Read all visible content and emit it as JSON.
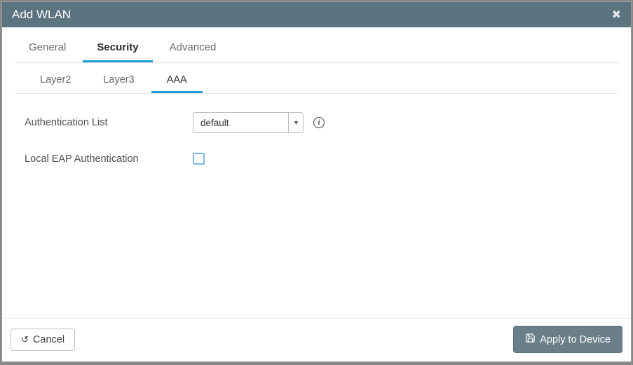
{
  "modal": {
    "title": "Add WLAN"
  },
  "tabs": {
    "general": "General",
    "security": "Security",
    "advanced": "Advanced"
  },
  "subtabs": {
    "layer2": "Layer2",
    "layer3": "Layer3",
    "aaa": "AAA"
  },
  "form": {
    "auth_list_label": "Authentication List",
    "auth_list_value": "default",
    "local_eap_label": "Local EAP Authentication",
    "local_eap_checked": false
  },
  "footer": {
    "cancel": "Cancel",
    "apply": "Apply to Device"
  },
  "icons": {
    "info": "i"
  }
}
